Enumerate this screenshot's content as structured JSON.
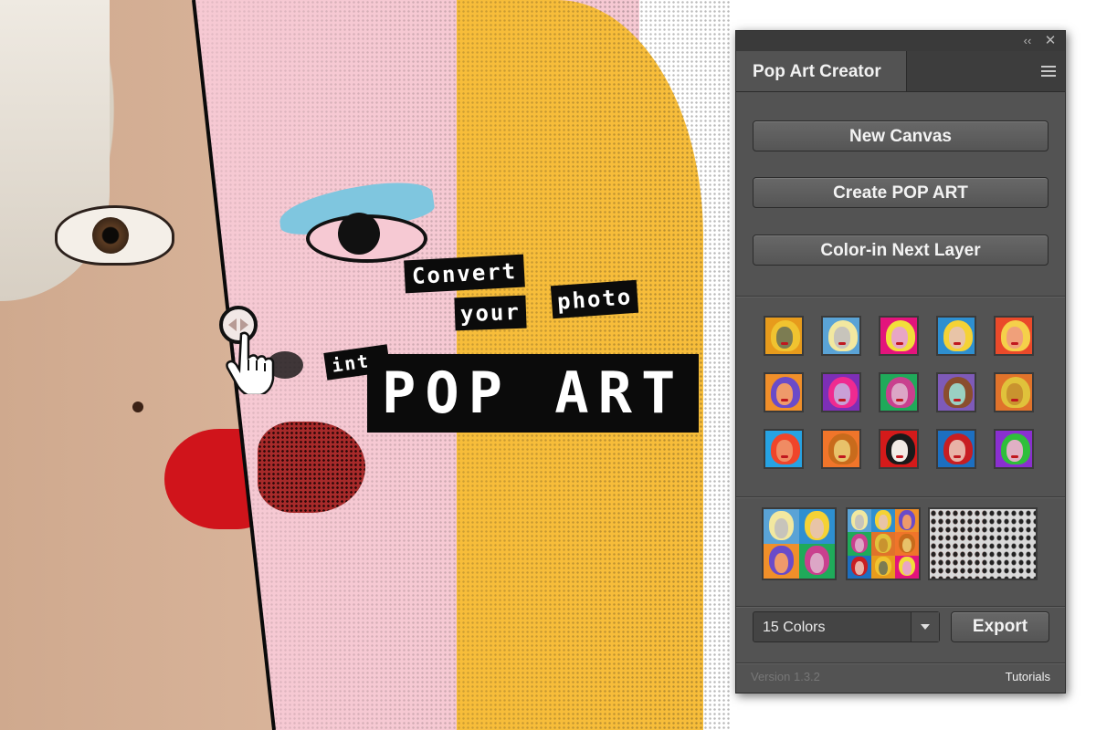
{
  "hero": {
    "lines": [
      "Convert",
      "your",
      "photo",
      "into",
      "POP ART"
    ]
  },
  "panel": {
    "title": "Pop Art Creator",
    "icons": {
      "collapse": "double-chevron-left-icon",
      "close": "close-icon",
      "menu": "hamburger-menu-icon"
    },
    "buttons": [
      "New Canvas",
      "Create POP ART",
      "Color-in Next Layer"
    ],
    "presets": [
      {
        "bg": "#e79b1c",
        "hair": "#f0c330",
        "face": "#7c7c52"
      },
      {
        "bg": "#5aa3d6",
        "hair": "#f2e8a0",
        "face": "#c7c4bb"
      },
      {
        "bg": "#e3147c",
        "hair": "#f2de3b",
        "face": "#e8a6c5"
      },
      {
        "bg": "#2e8fd0",
        "hair": "#f5d235",
        "face": "#e8c4a7"
      },
      {
        "bg": "#ea4a2a",
        "hair": "#f5d04a",
        "face": "#f0a07a"
      },
      {
        "bg": "#f08f2a",
        "hair": "#6a4bc9",
        "face": "#ef9a6a"
      },
      {
        "bg": "#7d2fb6",
        "hair": "#ef2a90",
        "face": "#c9a0d6"
      },
      {
        "bg": "#1faa5a",
        "hair": "#c9408e",
        "face": "#dca6c6"
      },
      {
        "bg": "#7e5ab8",
        "hair": "#8a4e2e",
        "face": "#9ad0c2"
      },
      {
        "bg": "#e0732b",
        "hair": "#e0c23b",
        "face": "#c9932f"
      },
      {
        "bg": "#26a3e3",
        "hair": "#f0452a",
        "face": "#f08b63"
      },
      {
        "bg": "#f0752a",
        "hair": "#c86b1c",
        "face": "#e8c26a"
      },
      {
        "bg": "#d41a1a",
        "hair": "#1a1a1a",
        "face": "#f2ece6"
      },
      {
        "bg": "#1d6fc0",
        "hair": "#c81e22",
        "face": "#e8b2a6"
      },
      {
        "bg": "#8a2fd0",
        "hair": "#2fbf3a",
        "face": "#e0b0c4"
      }
    ],
    "layouts": [
      {
        "name": "2x2 grid"
      },
      {
        "name": "3x3 grid"
      },
      {
        "name": "halftone pattern"
      }
    ],
    "colors_select": {
      "value": "15 Colors"
    },
    "export_label": "Export",
    "version": "Version 1.3.2",
    "tutorials": "Tutorials"
  }
}
